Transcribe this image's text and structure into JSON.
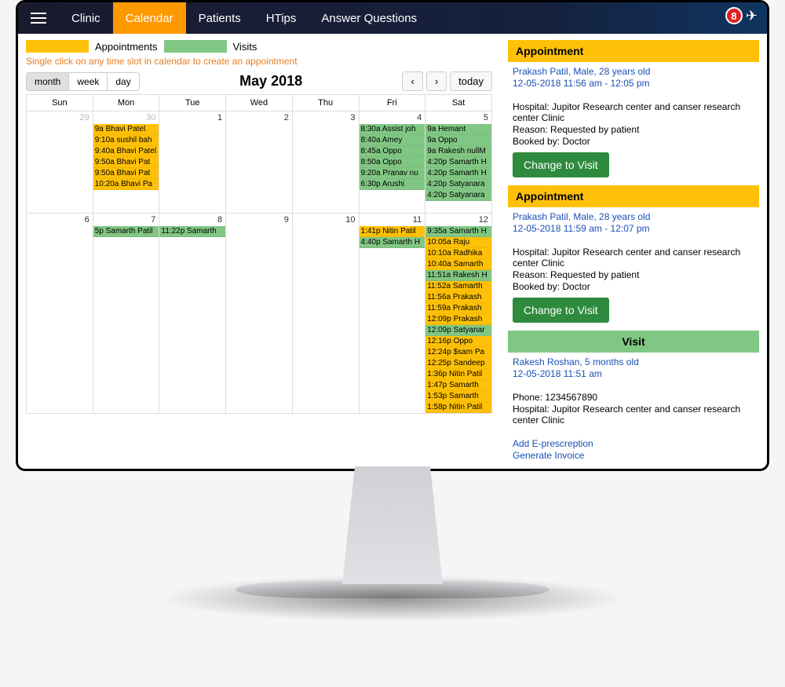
{
  "nav": {
    "items": [
      "Clinic",
      "Calendar",
      "Patients",
      "HTips",
      "Answer Questions"
    ],
    "active": 1,
    "badge": "8"
  },
  "legend": {
    "appointments": "Appointments",
    "visits": "Visits"
  },
  "help": "Single click on any time slot in calendar to create an appointment",
  "views": {
    "month": "month",
    "week": "week",
    "day": "day",
    "today": "today"
  },
  "title": "May 2018",
  "dayHeaders": [
    "Sun",
    "Mon",
    "Tue",
    "Wed",
    "Thu",
    "Fri",
    "Sat"
  ],
  "weeks": [
    [
      {
        "n": "29",
        "muted": true,
        "events": []
      },
      {
        "n": "30",
        "muted": true,
        "events": [
          {
            "t": "9a",
            "p": "Bhavi Patel",
            "c": "y"
          },
          {
            "t": "9:10a",
            "p": "sushil bah",
            "c": "y"
          },
          {
            "t": "9:40a",
            "p": "Bhavi Patel",
            "c": "y"
          },
          {
            "t": "9:50a",
            "p": "Bhavi Pat",
            "c": "y"
          },
          {
            "t": "9:50a",
            "p": "Bhavi Pat",
            "c": "y"
          },
          {
            "t": "10:20a",
            "p": "Bhavi Pa",
            "c": "y"
          }
        ]
      },
      {
        "n": "1",
        "events": []
      },
      {
        "n": "2",
        "events": []
      },
      {
        "n": "3",
        "events": []
      },
      {
        "n": "4",
        "events": [
          {
            "t": "8:30a",
            "p": "Assist joh",
            "c": "g"
          },
          {
            "t": "8:40a",
            "p": "Amey",
            "c": "g"
          },
          {
            "t": "8:45a",
            "p": "Oppo",
            "c": "g"
          },
          {
            "t": "8:50a",
            "p": "Oppo",
            "c": "g"
          },
          {
            "t": "9:20a",
            "p": "Pranav nu",
            "c": "g"
          },
          {
            "t": "6:30p",
            "p": "Arushi",
            "c": "g"
          }
        ]
      },
      {
        "n": "5",
        "events": [
          {
            "t": "9a",
            "p": "Hemant",
            "c": "g"
          },
          {
            "t": "9a",
            "p": "Oppo",
            "c": "g"
          },
          {
            "t": "9a",
            "p": "Rakesh nullM",
            "c": "g"
          },
          {
            "t": "4:20p",
            "p": "Samarth H",
            "c": "g"
          },
          {
            "t": "4:20p",
            "p": "Samarth H",
            "c": "g"
          },
          {
            "t": "4:20p",
            "p": "Satyanara",
            "c": "g"
          },
          {
            "t": "4:20p",
            "p": "Satyanara",
            "c": "g"
          }
        ]
      }
    ],
    [
      {
        "n": "6",
        "events": []
      },
      {
        "n": "7",
        "events": [
          {
            "t": "5p",
            "p": "Samarth Patil",
            "c": "g"
          }
        ]
      },
      {
        "n": "8",
        "events": [
          {
            "t": "11:22p",
            "p": "Samarth",
            "c": "g"
          }
        ]
      },
      {
        "n": "9",
        "events": []
      },
      {
        "n": "10",
        "events": []
      },
      {
        "n": "11",
        "events": [
          {
            "t": "1:41p",
            "p": "Nitin Patil",
            "c": "y"
          },
          {
            "t": "4:40p",
            "p": "Samarth H",
            "c": "g"
          }
        ]
      },
      {
        "n": "12",
        "events": [
          {
            "t": "9:35a",
            "p": "Samarth H",
            "c": "g"
          },
          {
            "t": "10:05a",
            "p": "Raju",
            "c": "y"
          },
          {
            "t": "10:10a",
            "p": "Radhika",
            "c": "y"
          },
          {
            "t": "10:40a",
            "p": "Samarth",
            "c": "y"
          },
          {
            "t": "11:51a",
            "p": "Rakesh H",
            "c": "g"
          },
          {
            "t": "11:52a",
            "p": "Samarth",
            "c": "y"
          },
          {
            "t": "11:56a",
            "p": "Prakash",
            "c": "y"
          },
          {
            "t": "11:59a",
            "p": "Prakash",
            "c": "y"
          },
          {
            "t": "12:09p",
            "p": "Prakash",
            "c": "y"
          },
          {
            "t": "12:09p",
            "p": "Satyanar",
            "c": "g"
          },
          {
            "t": "12:16p",
            "p": "Oppo",
            "c": "y"
          },
          {
            "t": "12:24p",
            "p": "$sam Pa",
            "c": "y"
          },
          {
            "t": "12:25p",
            "p": "Sandeep",
            "c": "y"
          },
          {
            "t": "1:36p",
            "p": "Nitin Patil",
            "c": "y"
          },
          {
            "t": "1:47p",
            "p": "Samarth",
            "c": "y"
          },
          {
            "t": "1:53p",
            "p": "Samarth",
            "c": "y"
          },
          {
            "t": "1:58p",
            "p": "Nitin Patil",
            "c": "y"
          }
        ]
      }
    ]
  ],
  "details": [
    {
      "type": "appt",
      "header": "Appointment",
      "name": "Prakash Patil, Male, 28 years old",
      "time": "12-05-2018 11:56 am - 12:05 pm",
      "hospital": "Hospital: Jupitor Research center and canser research center Clinic",
      "reason": "Reason: Requested by patient",
      "booked": "Booked by: Doctor",
      "button": "Change to Visit"
    },
    {
      "type": "appt",
      "header": "Appointment",
      "name": "Prakash Patil, Male, 28 years old",
      "time": "12-05-2018 11:59 am - 12:07 pm",
      "hospital": "Hospital: Jupitor Research center and canser research center Clinic",
      "reason": "Reason: Requested by patient",
      "booked": "Booked by: Doctor",
      "button": "Change to Visit"
    },
    {
      "type": "visit",
      "header": "Visit",
      "name": "Rakesh Roshan, 5 months old",
      "time": "12-05-2018 11:51 am",
      "phone": "Phone: 1234567890",
      "hospital": "Hospital: Jupitor Research center and canser research center Clinic",
      "link1": "Add E-prescreption",
      "link2": "Generate Invoice"
    }
  ]
}
